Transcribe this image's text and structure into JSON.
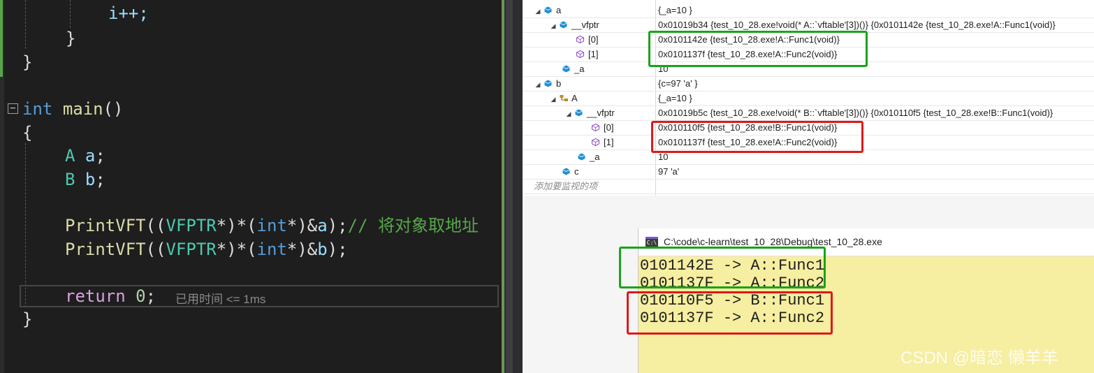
{
  "editor": {
    "lines": {
      "l1": "i++;",
      "l2": "}",
      "l3": "}",
      "main_kw": "int",
      "main_fn": "main",
      "main_paren": "()",
      "brace_open": "{",
      "decl_a_type": "A",
      "decl_a_var": "a",
      "decl_b_type": "B",
      "decl_b_var": "b",
      "semi": ";",
      "call_fn": "PrintVFT",
      "call_p1": "((",
      "call_type": "VFPTR",
      "call_p2": "*)*(",
      "call_int": "int",
      "call_p3": "*)&",
      "call_end": ");",
      "comment": "// 将对象取地址",
      "return_kw": "return",
      "return_val": "0",
      "brace_close": "}"
    },
    "inline_hint": "已用时间 <= 1ms"
  },
  "watch": {
    "rows": [
      {
        "name": "a",
        "value": "{_a=10 }"
      },
      {
        "name": "__vfptr",
        "value": "0x01019b34 {test_10_28.exe!void(* A::`vftable'[3])()} {0x0101142e {test_10_28.exe!A::Func1(void)}"
      },
      {
        "name": "[0]",
        "value": "0x0101142e {test_10_28.exe!A::Func1(void)}"
      },
      {
        "name": "[1]",
        "value": "0x0101137f {test_10_28.exe!A::Func2(void)}"
      },
      {
        "name": "_a",
        "value": "10"
      },
      {
        "name": "b",
        "value": "{c=97 'a' }"
      },
      {
        "name": "A",
        "value": "{_a=10 }"
      },
      {
        "name": "__vfptr",
        "value": "0x01019b5c {test_10_28.exe!void(* B::`vftable'[3])()} {0x010110f5 {test_10_28.exe!B::Func1(void)}"
      },
      {
        "name": "[0]",
        "value": "0x010110f5 {test_10_28.exe!B::Func1(void)}"
      },
      {
        "name": "[1]",
        "value": "0x0101137f {test_10_28.exe!A::Func2(void)}"
      },
      {
        "name": "_a",
        "value": "10"
      },
      {
        "name": "c",
        "value": "97 'a'"
      }
    ],
    "add_watch_placeholder": "添加要监视的项"
  },
  "console": {
    "title": "C:\\code\\c-learn\\test_10_28\\Debug\\test_10_28.exe",
    "icon_label": "C:\\",
    "lines": [
      "0101142E -> A::Func1",
      "0101137F -> A::Func2",
      "010110F5 -> B::Func1",
      "0101137F -> A::Func2"
    ]
  },
  "watermark": "CSDN @暗恋 懒羊羊",
  "colors": {
    "highlight_green": "#1aa31a",
    "highlight_red": "#e01818",
    "console_bg": "#f6eea0"
  }
}
